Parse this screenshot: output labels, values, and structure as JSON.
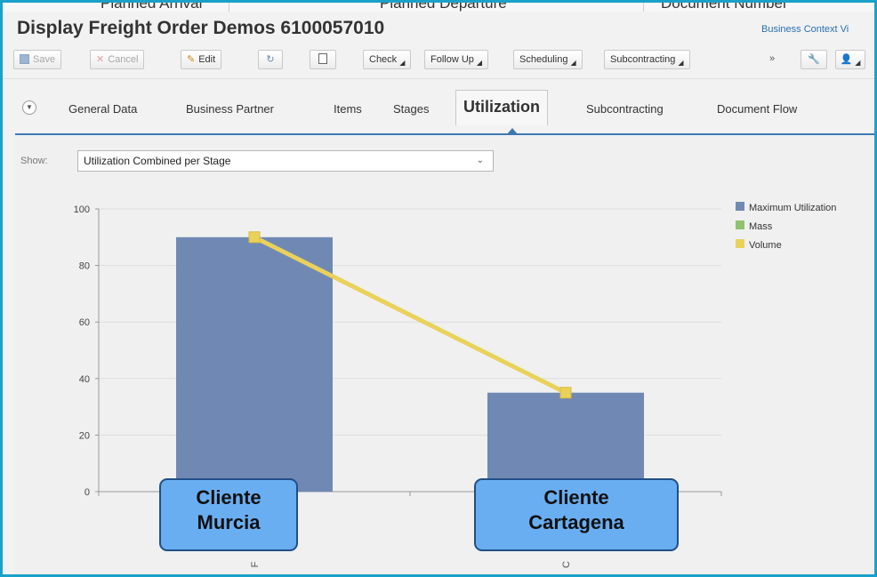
{
  "top_strip": {
    "columns": [
      "Planned Arrival",
      "Planned Departure",
      "Document Number"
    ]
  },
  "window": {
    "title": "Display Freight Order Demos 6100057010",
    "business_context": "Business Context Vi"
  },
  "toolbar": {
    "save_label": "Save",
    "cancel_label": "Cancel",
    "edit_label": "Edit",
    "check_label": "Check",
    "follow_up_label": "Follow Up",
    "scheduling_label": "Scheduling",
    "subcontracting_label": "Subcontracting",
    "overflow_label": "»"
  },
  "tabs": {
    "items": [
      "General Data",
      "Business Partner",
      "Items",
      "Stages",
      "Utilization",
      "Subcontracting",
      "Document Flow"
    ],
    "active": "Utilization"
  },
  "filter": {
    "label": "Show:",
    "value": "Utilization Combined per Stage"
  },
  "chart_data": {
    "type": "bar",
    "categories": [
      "F",
      "C"
    ],
    "yticks": [
      0,
      20,
      40,
      60,
      80,
      100
    ],
    "ylim": [
      0,
      100
    ],
    "series": [
      {
        "name": "Maximum Utilization",
        "type": "bar",
        "color": "#7089b4",
        "values": [
          90,
          35
        ]
      },
      {
        "name": "Mass",
        "type": "line",
        "color": "#8fc36e",
        "values": []
      },
      {
        "name": "Volume",
        "type": "line",
        "color": "#ead15a",
        "values": [
          90,
          35
        ]
      }
    ],
    "legend_position": "top-right",
    "grid": true
  },
  "callouts": [
    {
      "line1": "Cliente",
      "line2": "Murcia"
    },
    {
      "line1": "Cliente",
      "line2": "Cartagena"
    }
  ],
  "colors": {
    "frame": "#1aa1c9",
    "tab_underline": "#3e78b3",
    "callout_fill": "#6aaef2",
    "callout_border": "#1f4f87"
  }
}
